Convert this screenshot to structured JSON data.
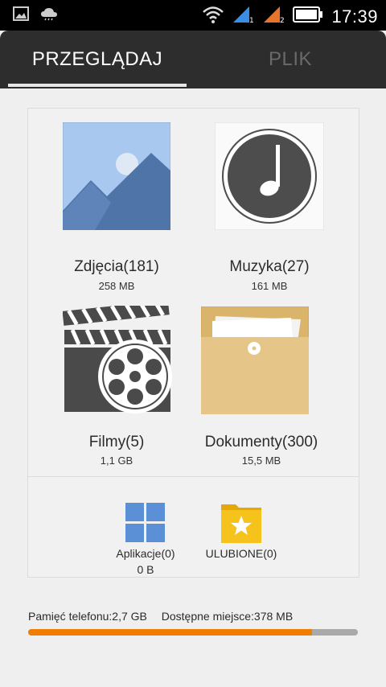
{
  "status_bar": {
    "time": "17:39",
    "sim1_label": "1",
    "sim2_label": "2"
  },
  "tabs": [
    {
      "label": "PRZEGLĄDAJ",
      "active": true
    },
    {
      "label": "PLIK",
      "active": false
    }
  ],
  "categories": [
    {
      "label": "Zdjęcia(181)",
      "size": "258 MB",
      "icon": "photos-icon"
    },
    {
      "label": "Muzyka(27)",
      "size": "161 MB",
      "icon": "music-icon"
    },
    {
      "label": "Filmy(5)",
      "size": "1,1 GB",
      "icon": "film-icon"
    },
    {
      "label": "Dokumenty(300)",
      "size": "15,5 MB",
      "icon": "documents-icon"
    }
  ],
  "secondary": [
    {
      "label": "Aplikacje(0)",
      "size": "0 B",
      "icon": "apps-grid-icon"
    },
    {
      "label": "ULUBIONE(0)",
      "size": "",
      "icon": "favorites-folder-icon"
    }
  ],
  "storage": {
    "phone_memory": "Pamięć telefonu:2,7 GB",
    "available": "Dostępne miejsce:378 MB",
    "used_fraction": 0.86
  },
  "colors": {
    "accent_orange": "#f07d00",
    "tabbar_bg": "#2d2d2d",
    "background": "#efefef"
  }
}
